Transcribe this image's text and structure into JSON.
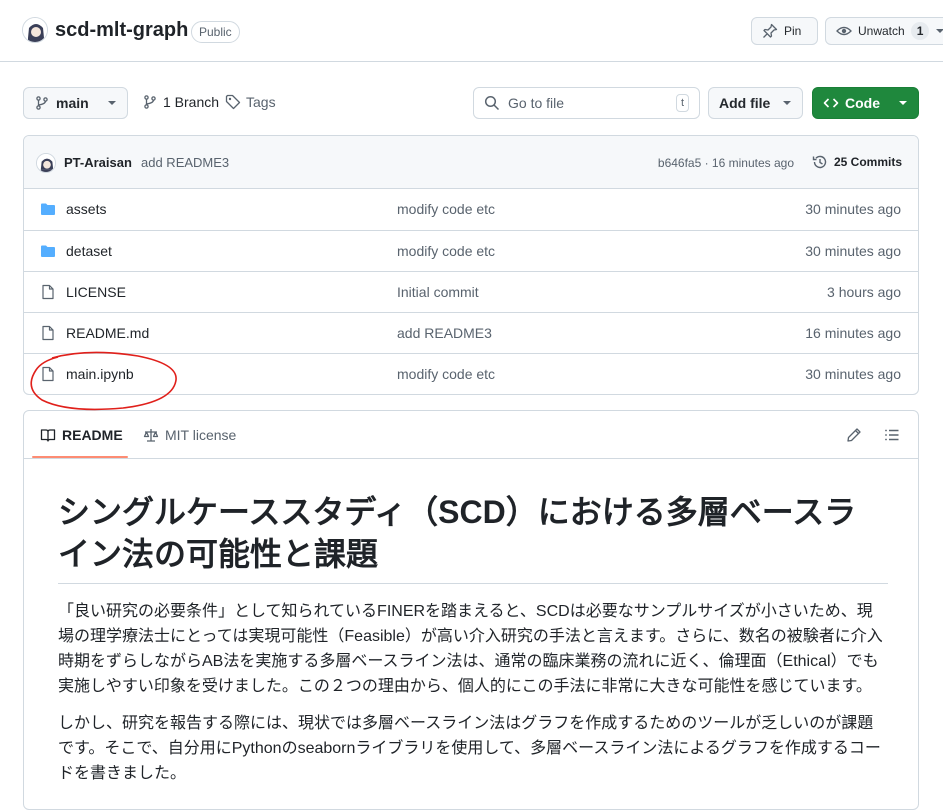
{
  "repo": {
    "name": "scd-mlt-graph",
    "visibility": "Public",
    "pin_label": "Pin",
    "watch_label": "Unwatch",
    "watch_count": "1"
  },
  "nav": {
    "branch": "main",
    "branches_link": "1 Branch",
    "tags_link": "Tags",
    "goto_placeholder": "Go to file",
    "goto_shortcut": "t",
    "add_file": "Add file",
    "code": "Code"
  },
  "commit": {
    "author": "PT-Araisan",
    "message": "add README3",
    "hash_time": "b646fa5 · 16 minutes ago",
    "commits": "25 Commits"
  },
  "files": [
    {
      "name": "assets",
      "type": "folder",
      "message": "modify code etc",
      "date": "30 minutes ago"
    },
    {
      "name": "detaset",
      "type": "folder",
      "message": "modify code etc",
      "date": "30 minutes ago"
    },
    {
      "name": "LICENSE",
      "type": "file",
      "message": "Initial commit",
      "date": "3 hours ago"
    },
    {
      "name": "README.md",
      "type": "file",
      "message": "add README3",
      "date": "16 minutes ago"
    },
    {
      "name": "main.ipynb",
      "type": "file",
      "message": "modify code etc",
      "date": "30 minutes ago"
    }
  ],
  "readme": {
    "tab_readme": "README",
    "tab_license": "MIT license",
    "title": "シングルケーススタディ（SCD）における多層ベースライン法の可能性と課題",
    "para1": "「良い研究の必要条件」として知られているFINERを踏まえると、SCDは必要なサンプルサイズが小さいため、現場の理学療法士にとっては実現可能性（Feasible）が高い介入研究の手法と言えます。さらに、数名の被験者に介入時期をずらしながらAB法を実施する多層ベースライン法は、通常の臨床業務の流れに近く、倫理面（Ethical）でも実施しやすい印象を受けました。この２つの理由から、個人的にこの手法に非常に大きな可能性を感じています。",
    "para2": "しかし、研究を報告する際には、現状では多層ベースライン法はグラフを作成するためのツールが乏しいのが課題です。そこで、自分用にPythonのseabornライブラリを使用して、多層ベースライン法によるグラフを作成するコードを書きました。"
  },
  "colors": {
    "accent_green": "#1f883d",
    "folder_blue": "#54aeff",
    "annotation_red": "#e0201b",
    "tab_underline": "#fd8c73"
  }
}
